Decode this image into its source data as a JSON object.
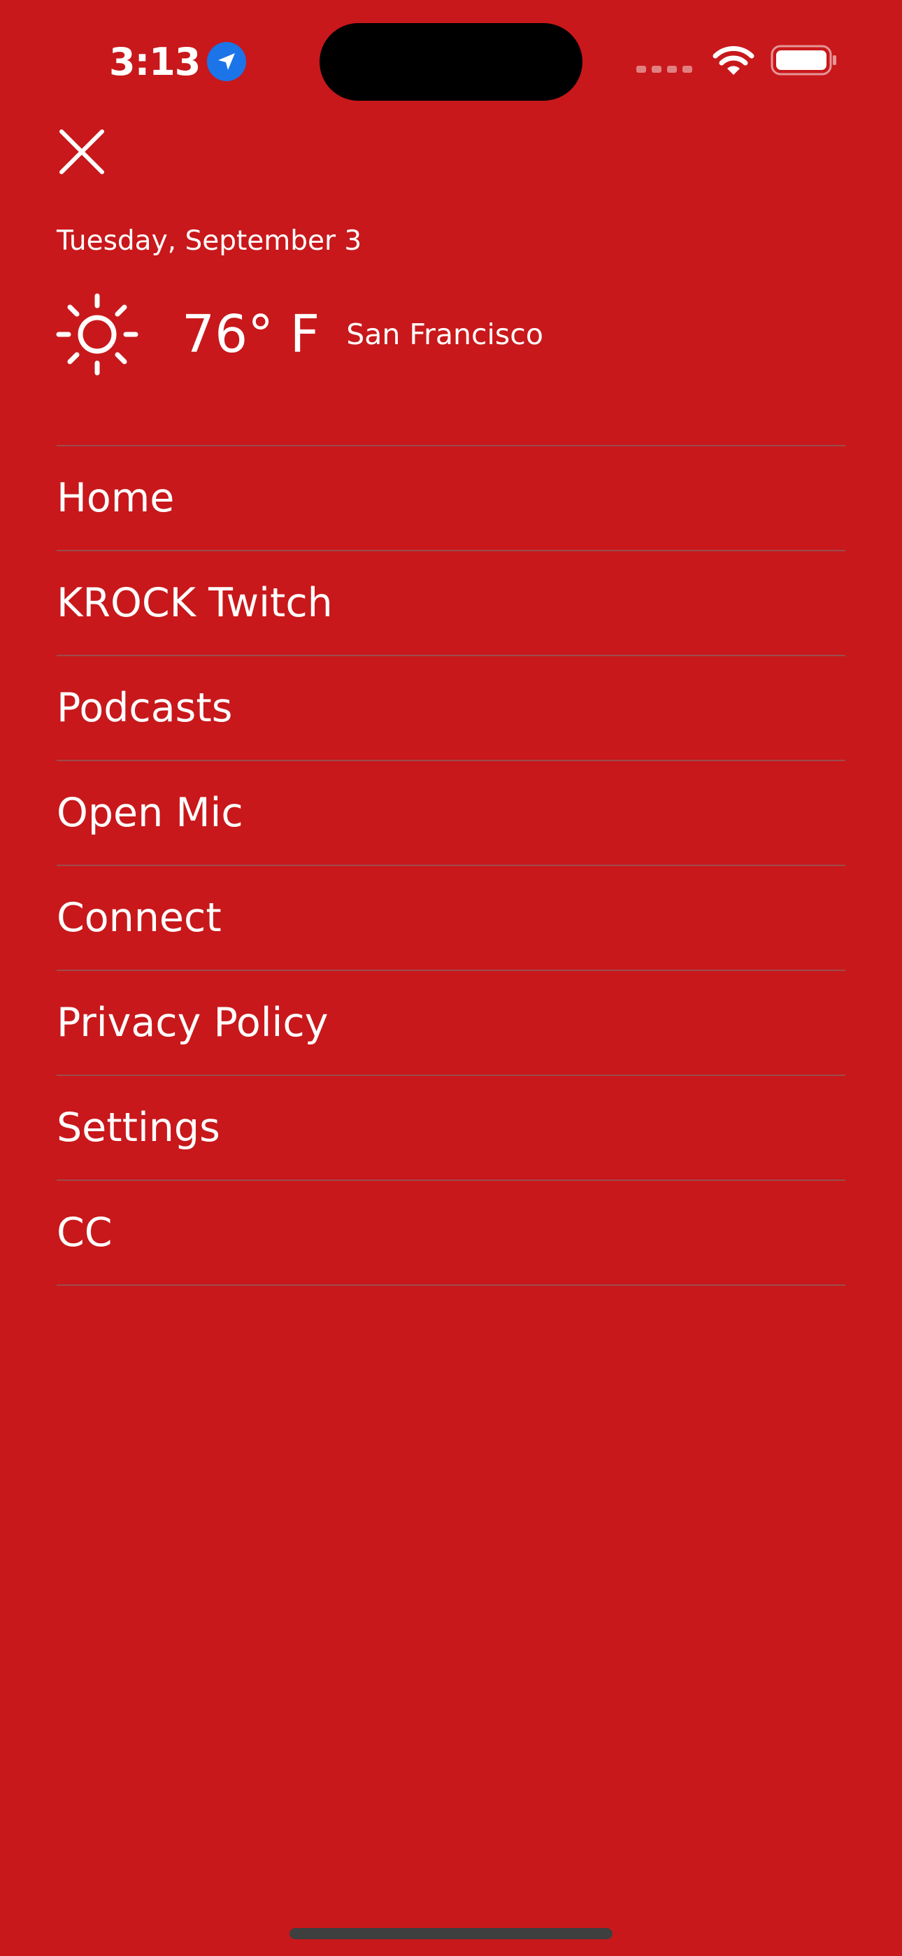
{
  "status_bar": {
    "time": "3:13",
    "icons": [
      "location-arrow-icon",
      "cellular-signal-icon",
      "wifi-icon",
      "battery-icon"
    ]
  },
  "header": {
    "close_icon": "close-icon",
    "date": "Tuesday, September 3"
  },
  "weather": {
    "icon": "sun-icon",
    "temperature": "76° F",
    "city": "San Francisco"
  },
  "menu": {
    "items": [
      {
        "label": "Home"
      },
      {
        "label": "KROCK Twitch"
      },
      {
        "label": "Podcasts"
      },
      {
        "label": "Open Mic"
      },
      {
        "label": "Connect"
      },
      {
        "label": "Privacy Policy"
      },
      {
        "label": "Settings"
      },
      {
        "label": "CC"
      }
    ]
  },
  "colors": {
    "background": "#c8181b",
    "text": "#ffffff",
    "divider": "#787878",
    "location_badge": "#1b74e8"
  }
}
